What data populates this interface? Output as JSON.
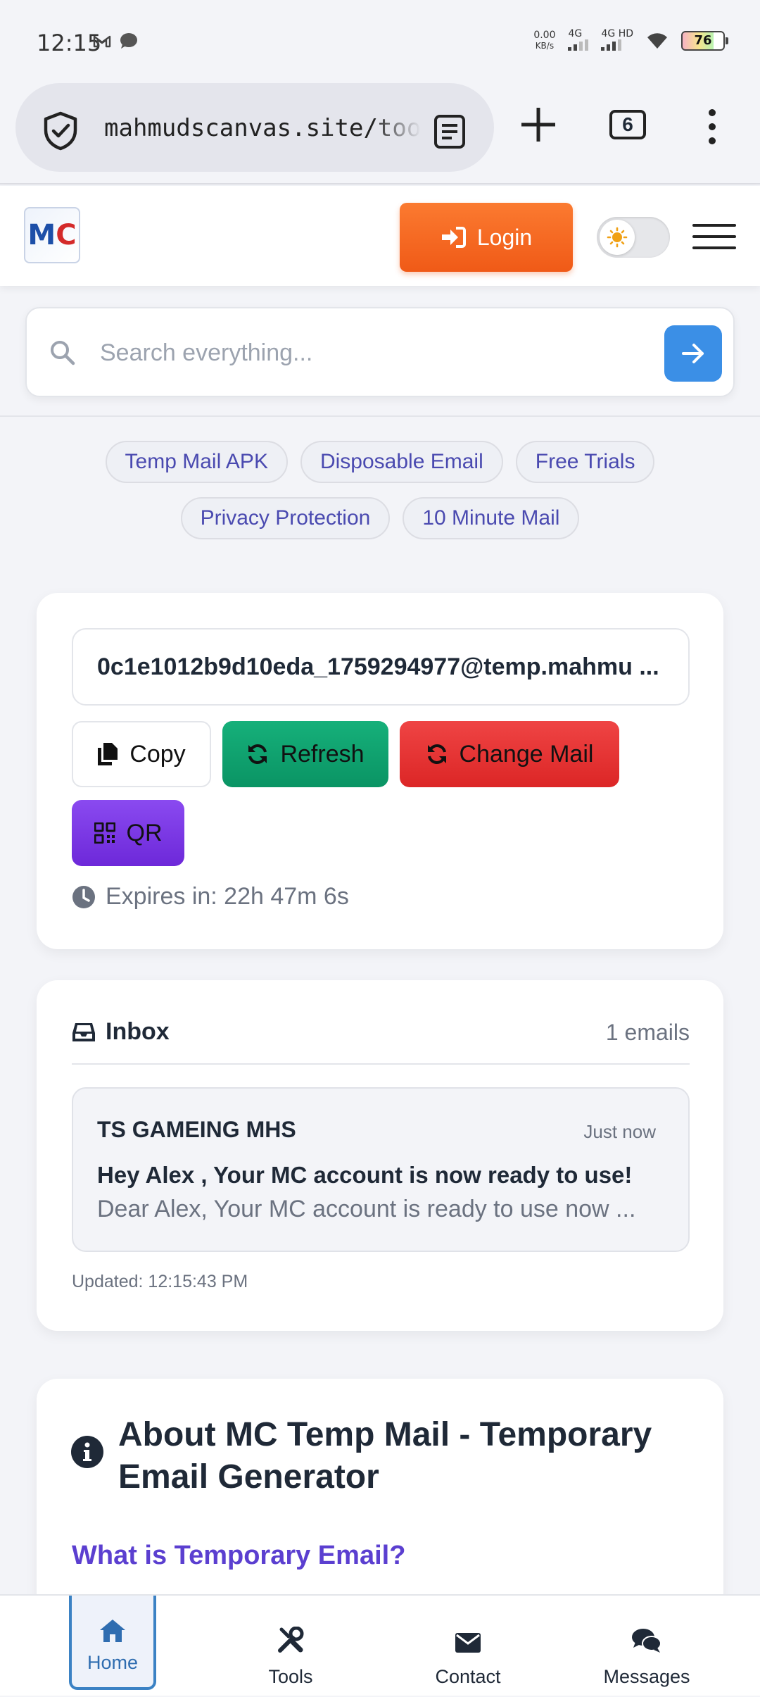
{
  "status_bar": {
    "time": "12:15",
    "speed_value": "0.00",
    "speed_unit": "KB/s",
    "net1": "4G",
    "net2": "4G HD",
    "battery": "76"
  },
  "browser": {
    "url": "mahmudscanvas.site/tools/temp-mail",
    "tab_count": "6"
  },
  "header": {
    "logo_m": "M",
    "logo_c": "C",
    "login_label": "Login"
  },
  "search": {
    "placeholder": "Search everything..."
  },
  "chips": {
    "row1": [
      "Temp Mail APK",
      "Disposable Email",
      "Free Trials"
    ],
    "row2": [
      "Privacy Protection",
      "10 Minute Mail"
    ]
  },
  "mail_card": {
    "email": "0c1e1012b9d10eda_1759294977@temp.mahmu ...",
    "copy_label": "Copy",
    "refresh_label": "Refresh",
    "change_label": "Change Mail",
    "qr_label": "QR",
    "expires": "Expires in: 22h 47m 6s"
  },
  "inbox": {
    "title": "Inbox",
    "count": "1 emails",
    "messages": [
      {
        "from": "TS GAMEING MHS",
        "time": "Just now",
        "subject": "Hey Alex , Your MC account is now ready to use!",
        "preview": "Dear Alex, Your MC account is ready to use now ..."
      }
    ],
    "updated": "Updated: 12:15:43 PM"
  },
  "about": {
    "title": "About MC Temp Mail - Temporary Email Generator",
    "subtitle": "What is Temporary Email?"
  },
  "bottom_nav": {
    "items": [
      {
        "label": "Home",
        "icon": "home-icon"
      },
      {
        "label": "Tools",
        "icon": "tools-icon"
      },
      {
        "label": "Contact",
        "icon": "envelope-icon"
      },
      {
        "label": "Messages",
        "icon": "chat-icon"
      }
    ]
  },
  "colors": {
    "login": "#f05a17",
    "refresh": "#0a9464",
    "change": "#dc2626",
    "qr": "#6d28d9",
    "search_go": "#3b8fe6",
    "chip_text": "#4a4ab0",
    "about_sub": "#5b3fd0"
  }
}
